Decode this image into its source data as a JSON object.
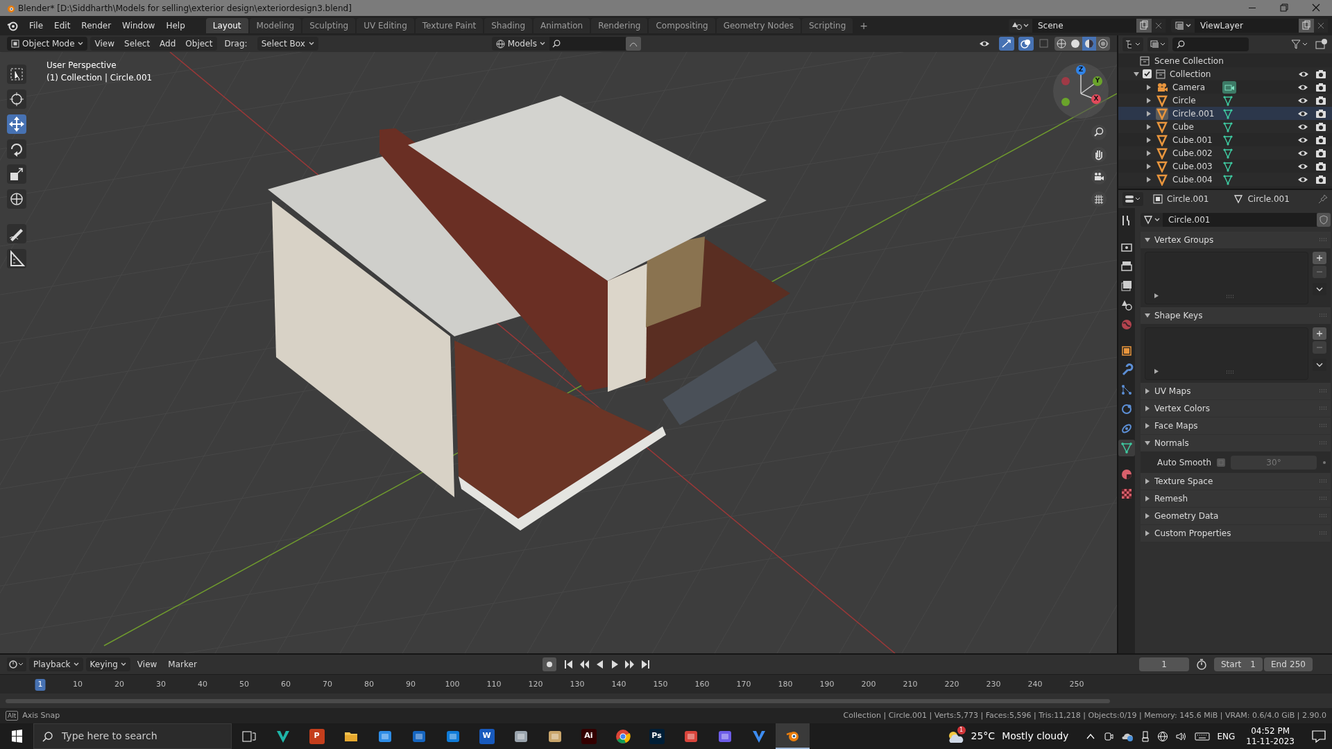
{
  "window": {
    "title": "Blender* [D:\\Siddharth\\Models for selling\\exterior design\\exteriordesign3.blend]"
  },
  "menu": [
    "File",
    "Edit",
    "Render",
    "Window",
    "Help"
  ],
  "workspaces": [
    {
      "label": "Layout",
      "selected": true
    },
    {
      "label": "Modeling",
      "selected": false
    },
    {
      "label": "Sculpting",
      "selected": false
    },
    {
      "label": "UV Editing",
      "selected": false
    },
    {
      "label": "Texture Paint",
      "selected": false
    },
    {
      "label": "Shading",
      "selected": false
    },
    {
      "label": "Animation",
      "selected": false
    },
    {
      "label": "Rendering",
      "selected": false
    },
    {
      "label": "Compositing",
      "selected": false
    },
    {
      "label": "Geometry Nodes",
      "selected": false
    },
    {
      "label": "Scripting",
      "selected": false
    }
  ],
  "add_workspace": "+",
  "scene": "Scene",
  "view_layer": "ViewLayer",
  "viewport_header": {
    "mode": "Object Mode",
    "menus": [
      "View",
      "Select",
      "Add",
      "Object"
    ],
    "drag_label": "Drag:",
    "drag_value": "Select Box",
    "orientation": "Models"
  },
  "viewport": {
    "overlay_lines": [
      "User Perspective",
      "(1) Collection | Circle.001"
    ],
    "gizmo_axes": [
      "Z",
      "Y",
      "X"
    ],
    "tools": [
      {
        "kind": "select",
        "selected": false
      },
      {
        "kind": "cursor",
        "selected": false
      },
      {
        "kind": "move",
        "selected": true
      },
      {
        "kind": "rotate",
        "selected": false
      },
      {
        "kind": "scale",
        "selected": false
      },
      {
        "kind": "transform",
        "selected": false
      },
      {
        "kind": "annotate",
        "selected": false
      },
      {
        "kind": "measure",
        "selected": false
      }
    ]
  },
  "outliner": {
    "root": "Scene Collection",
    "collection": {
      "label": "Collection",
      "checked": true,
      "expanded": true,
      "children": [
        {
          "label": "Camera",
          "kind": "camera",
          "selected": false
        },
        {
          "label": "Circle",
          "kind": "mesh",
          "selected": false
        },
        {
          "label": "Circle.001",
          "kind": "mesh",
          "selected": true
        },
        {
          "label": "Cube",
          "kind": "mesh",
          "selected": false
        },
        {
          "label": "Cube.001",
          "kind": "mesh",
          "selected": false
        },
        {
          "label": "Cube.002",
          "kind": "mesh",
          "selected": false
        },
        {
          "label": "Cube.003",
          "kind": "mesh",
          "selected": false
        },
        {
          "label": "Cube.004",
          "kind": "mesh",
          "selected": false
        }
      ]
    }
  },
  "properties": {
    "object_name": "Circle.001",
    "data_name": "Circle.001",
    "mesh_name": "Circle.001",
    "tabs": [
      {
        "kind": "tool",
        "selected": false
      },
      {
        "kind": "render",
        "selected": false
      },
      {
        "kind": "output",
        "selected": false
      },
      {
        "kind": "view_layer",
        "selected": false
      },
      {
        "kind": "scene",
        "selected": false
      },
      {
        "kind": "world",
        "selected": false
      },
      {
        "kind": "object",
        "selected": false
      },
      {
        "kind": "modifiers",
        "selected": false
      },
      {
        "kind": "particles",
        "selected": false
      },
      {
        "kind": "physics",
        "selected": false
      },
      {
        "kind": "constraints",
        "selected": false
      },
      {
        "kind": "data",
        "selected": true
      },
      {
        "kind": "material",
        "selected": false
      },
      {
        "kind": "texture",
        "selected": false
      }
    ],
    "panels": [
      {
        "label": "Vertex Groups",
        "expanded": true,
        "kind": "list"
      },
      {
        "label": "Shape Keys",
        "expanded": true,
        "kind": "list"
      },
      {
        "label": "UV Maps",
        "expanded": false
      },
      {
        "label": "Vertex Colors",
        "expanded": false
      },
      {
        "label": "Face Maps",
        "expanded": false
      },
      {
        "label": "Normals",
        "expanded": true,
        "kind": "normals",
        "field_label": "Auto Smooth",
        "checked": false,
        "angle": "30°"
      },
      {
        "label": "Texture Space",
        "expanded": false
      },
      {
        "label": "Remesh",
        "expanded": false
      },
      {
        "label": "Geometry Data",
        "expanded": false
      },
      {
        "label": "Custom Properties",
        "expanded": false
      }
    ]
  },
  "timeline": {
    "menus": [
      "Playback",
      "Keying",
      "View",
      "Marker"
    ],
    "current_frame": "1",
    "start_label": "Start",
    "start": "1",
    "end_label": "End",
    "end": "250",
    "ruler": [
      "1",
      "10",
      "20",
      "30",
      "40",
      "50",
      "60",
      "70",
      "80",
      "90",
      "100",
      "110",
      "120",
      "130",
      "140",
      "150",
      "160",
      "170",
      "180",
      "190",
      "200",
      "210",
      "220",
      "230",
      "240",
      "250"
    ]
  },
  "status_bar": {
    "key": "Alt",
    "left": "Axis Snap",
    "right": "Collection | Circle.001 | Verts:5,773 | Faces:5,596 | Tris:11,218 | Objects:0/19 | Memory: 145.6 MiB | VRAM: 0.6/4.0 GiB | 2.90.0"
  },
  "taskbar": {
    "search_placeholder": "Type here to search",
    "apps": [
      {
        "kind": "taskview",
        "active": false
      },
      {
        "kind": "v",
        "color": "#1fb5a8",
        "active": false
      },
      {
        "kind": "glyph",
        "glyph": "P",
        "color": "#c43e1c",
        "active": false
      },
      {
        "kind": "folder",
        "color": "#f2c14e",
        "active": false
      },
      {
        "kind": "tile",
        "color": "#2d8ce6",
        "active": false
      },
      {
        "kind": "tile",
        "color": "#1565c0",
        "active": false
      },
      {
        "kind": "tile",
        "color": "#0f7bd8",
        "active": false
      },
      {
        "kind": "glyph",
        "glyph": "W",
        "color": "#185abd",
        "active": false
      },
      {
        "kind": "tile",
        "color": "#9aa4ad",
        "active": false
      },
      {
        "kind": "tile",
        "color": "#c9a56b",
        "active": false
      },
      {
        "kind": "glyph",
        "glyph": "Ai",
        "color": "#330000",
        "active": false
      },
      {
        "kind": "chrome",
        "active": false
      },
      {
        "kind": "glyph",
        "glyph": "Ps",
        "color": "#001e36",
        "active": false
      },
      {
        "kind": "tile",
        "color": "#d9443b",
        "active": false
      },
      {
        "kind": "tile",
        "color": "#6d5ce8",
        "active": false
      },
      {
        "kind": "v",
        "color": "#3d8cf0",
        "active": false
      },
      {
        "kind": "blender",
        "active": true
      }
    ],
    "weather_badge": "1",
    "temperature": "25°C",
    "weather": "Mostly cloudy",
    "language": "ENG",
    "time": "04:52 PM",
    "date": "11-11-2023"
  }
}
